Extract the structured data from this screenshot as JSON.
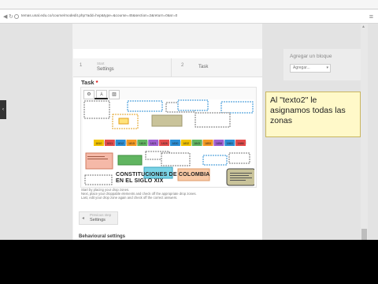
{
  "browser": {
    "url": "temas.unal.edu.co/course/modedit.php?add=hvp&type=&course=45&section=2&return=0&sr=0",
    "menu_icon": "menu-icon"
  },
  "breadcrumb": {
    "step1_number": "1",
    "step1_small": "Start",
    "step1_label": "Settings",
    "step2_number": "2",
    "step2_label": "Task"
  },
  "task": {
    "title": "Task",
    "required_mark": "*",
    "tools": [
      "settings-icon",
      "text-icon",
      "image-icon"
    ],
    "tooltip": "Text"
  },
  "canvas": {
    "years": [
      "1810",
      "1811",
      "1812",
      "1815",
      "1819",
      "1821",
      "1828",
      "1830",
      "1832",
      "1843",
      "1853",
      "1858",
      "1863",
      "1886"
    ],
    "year_colors": [
      "#f2c300",
      "#e34b4b",
      "#2c8fd6",
      "#f59a23",
      "#61b561",
      "#a05ed1",
      "#e34b4b",
      "#2c8fd6",
      "#f2c300",
      "#61b561",
      "#f59a23",
      "#a05ed1",
      "#2c8fd6",
      "#e34b4b"
    ],
    "heading_line1": "CONSTITUCIONES DE COLOMBIA",
    "heading_line2": "EN EL SIGLO XIX"
  },
  "hint_lines": [
    "Start by placing your drop zones.",
    "Next, place your droppable elements and check off the appropriate drop zones.",
    "Last, edit your drop zone again and check off the correct answers."
  ],
  "footer": {
    "prev_small": "Previous step",
    "prev_label": "Settings",
    "cut_heading": "Behavioural settings"
  },
  "sidebar_right": {
    "title": "Agregar un bloque",
    "select_value": "Agregar..."
  },
  "callout": {
    "text": "Al \"texto2\" le asignamos todas las zonas"
  },
  "colors": {
    "callout_bg": "#fff9c9",
    "accent_blue": "#2c8fd6"
  }
}
